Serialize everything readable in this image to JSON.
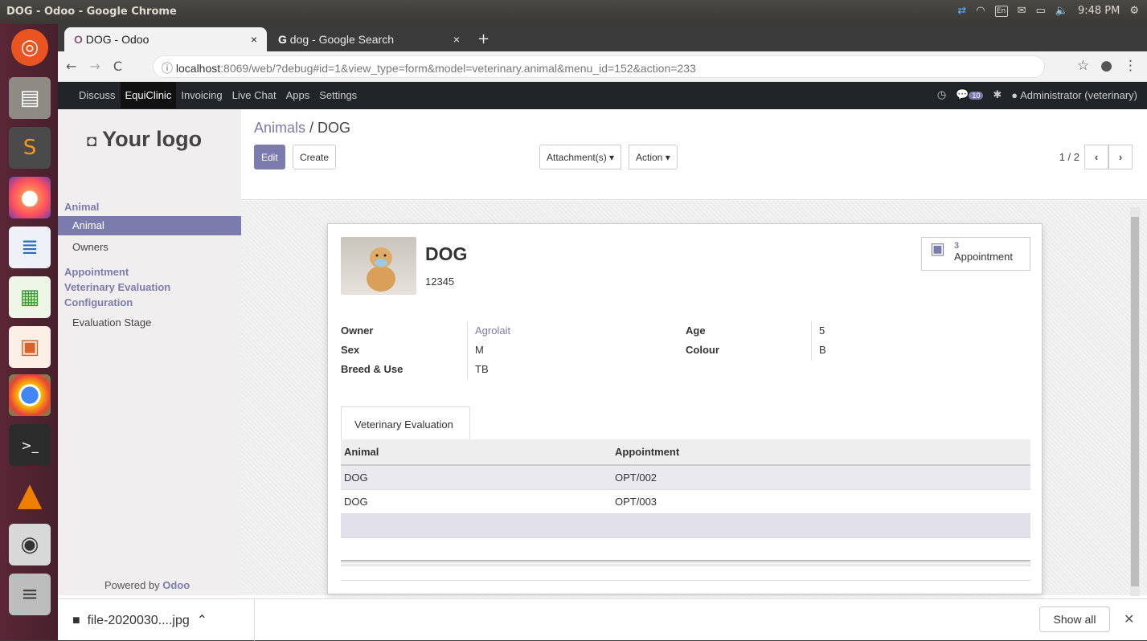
{
  "os": {
    "window_title": "DOG - Odoo - Google Chrome",
    "time": "9:48 PM",
    "keyboard": "En"
  },
  "launcher": {
    "icons": [
      "ubuntu-icon",
      "files-icon",
      "sublime-icon",
      "firefox-icon",
      "writer-icon",
      "calc-icon",
      "impress-icon",
      "chrome-icon",
      "terminal-icon",
      "vlc-icon",
      "camera-icon",
      "workspace-icon"
    ]
  },
  "browser": {
    "tabs": [
      {
        "label": "DOG - Odoo"
      },
      {
        "label": "dog - Google Search"
      }
    ],
    "url_host": "localhost",
    "url_rest": ":8069/web/?debug#id=1&view_type=form&model=veterinary.animal&menu_id=152&action=233"
  },
  "odoo_menu": {
    "items": [
      "Discuss",
      "EquiClinic",
      "Invoicing",
      "Live Chat",
      "Apps",
      "Settings"
    ],
    "active": "EquiClinic",
    "chat_count": "10",
    "user": "Administrator (veterinary)"
  },
  "sidebar": {
    "logo": "Your logo",
    "sections": [
      {
        "title": "Animal",
        "items": [
          "Animal",
          "Owners"
        ]
      },
      {
        "title": "Appointment"
      },
      {
        "title": "Veterinary Evaluation"
      },
      {
        "title": "Configuration",
        "items": [
          "Evaluation Stage"
        ]
      }
    ],
    "powered_prefix": "Powered by",
    "powered_brand": "Odoo"
  },
  "control_panel": {
    "breadcrumb_parent": "Animals",
    "breadcrumb_sep": " / ",
    "breadcrumb_current": "DOG",
    "edit": "Edit",
    "create": "Create",
    "attachments": "Attachment(s)",
    "action": "Action",
    "pager": "1 / 2"
  },
  "record": {
    "name": "DOG",
    "code": "12345",
    "appointment_count": "3",
    "appointment_label": "Appointment",
    "fields": {
      "owner_label": "Owner",
      "owner": "Agrolait",
      "sex_label": "Sex",
      "sex": "M",
      "breed_label": "Breed & Use",
      "breed": "TB",
      "age_label": "Age",
      "age": "5",
      "colour_label": "Colour",
      "colour": "B"
    },
    "tab": "Veterinary Evaluation",
    "table": {
      "headers": [
        "Animal",
        "Appointment"
      ],
      "rows": [
        [
          "DOG",
          "OPT/002"
        ],
        [
          "DOG",
          "OPT/003"
        ]
      ]
    }
  },
  "downloads": {
    "file": "file-2020030....jpg",
    "show_all": "Show all"
  },
  "colors": {
    "accent": "#7c7bad",
    "odoo_bar": "#212529",
    "launcher": "#5a2635"
  }
}
